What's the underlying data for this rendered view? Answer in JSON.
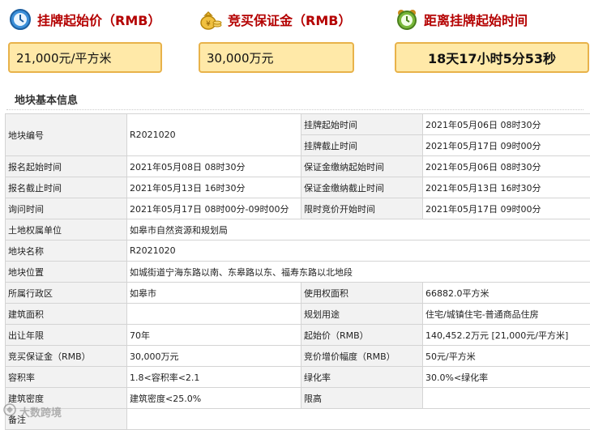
{
  "cards": [
    {
      "title": "挂牌起始价（RMB）",
      "value": "21,000元/平方米",
      "icon": "clock-icon"
    },
    {
      "title": "竞买保证金（RMB）",
      "value": "30,000万元",
      "icon": "money-bag-icon"
    },
    {
      "title": "距离挂牌起始时间",
      "value": "18天17小时5分53秒",
      "icon": "alarm-clock-icon"
    }
  ],
  "section_title": "地块基本信息",
  "rows": {
    "r1": {
      "k1": "地块编号",
      "v1": "R2021020",
      "k2a": "挂牌起始时间",
      "v2a": "2021年05月06日 08时30分",
      "k2b": "挂牌截止时间",
      "v2b": "2021年05月17日 09时00分"
    },
    "r2": {
      "k1": "报名起始时间",
      "v1": "2021年05月08日 08时30分",
      "k2": "保证金缴纳起始时间",
      "v2": "2021年05月06日 08时30分"
    },
    "r3": {
      "k1": "报名截止时间",
      "v1": "2021年05月13日 16时30分",
      "k2": "保证金缴纳截止时间",
      "v2": "2021年05月13日 16时30分"
    },
    "r4": {
      "k1": "询问时间",
      "v1": "2021年05月17日 08时00分-09时00分",
      "k2": "限时竞价开始时间",
      "v2": "2021年05月17日 09时00分"
    },
    "r5": {
      "k1": "土地权属单位",
      "v1": "如皋市自然资源和规划局"
    },
    "r6": {
      "k1": "地块名称",
      "v1": "R2021020"
    },
    "r7": {
      "k1": "地块位置",
      "v1": "如城街道宁海东路以南、东皋路以东、福寿东路以北地段"
    },
    "r8": {
      "k1": "所属行政区",
      "v1": "如皋市",
      "k2": "使用权面积",
      "v2": "66882.0平方米"
    },
    "r9": {
      "k1": "建筑面积",
      "v1": "",
      "k2": "规划用途",
      "v2": "住宅/城镇住宅-普通商品住房"
    },
    "r10": {
      "k1": "出让年限",
      "v1": "70年",
      "k2": "起始价（RMB）",
      "v2": "140,452.2万元 [21,000元/平方米]"
    },
    "r11": {
      "k1": "竞买保证金（RMB）",
      "v1": "30,000万元",
      "k2": "竞价增价幅度（RMB）",
      "v2": "50元/平方米"
    },
    "r12": {
      "k1": "容积率",
      "v1": "1.8<容积率<2.1",
      "k2": "绿化率",
      "v2": "30.0%<绿化率"
    },
    "r13": {
      "k1": "建筑密度",
      "v1": "建筑密度<25.0%",
      "k2": "限高",
      "v2": ""
    },
    "r14": {
      "k1": "备注",
      "v1": ""
    }
  },
  "watermark": "大数跨境"
}
